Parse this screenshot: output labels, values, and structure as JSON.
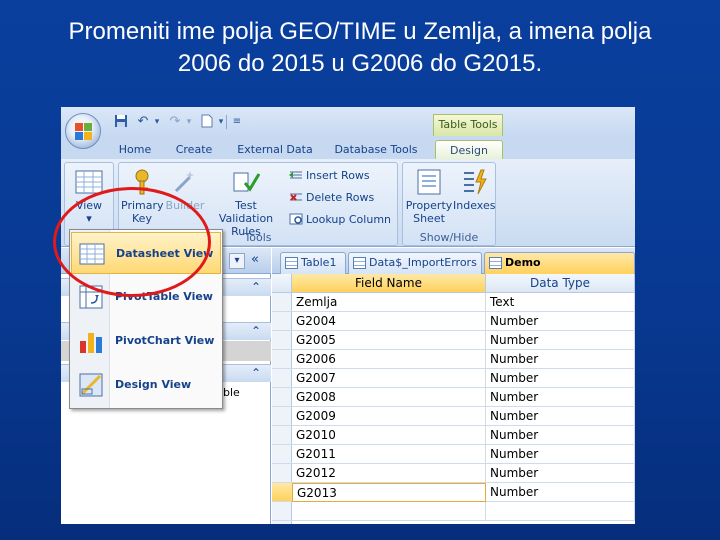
{
  "slide": {
    "title_line1": "Promeniti ime polja GEO/TIME u Zemlja, a imena polja",
    "title_line2": "2006 do 2015 u G2006 do G2015."
  },
  "titlebar": {
    "context_title": "Table Tools"
  },
  "tabs": [
    {
      "label": "Home"
    },
    {
      "label": "Create"
    },
    {
      "label": "External Data"
    },
    {
      "label": "Database Tools"
    },
    {
      "label": "Design",
      "active": true
    }
  ],
  "ribbon": {
    "view": {
      "label": "View",
      "arrow": "▾"
    },
    "tools": {
      "group_label": "Tools",
      "primary_key": "Primary Key",
      "primary_key_l1": "Primary",
      "primary_key_l2": "Key",
      "builder": "Builder",
      "test_validation_l1": "Test Validation",
      "test_validation_l2": "Rules",
      "insert_rows": "Insert Rows",
      "delete_rows": "Delete Rows",
      "lookup_column": "Lookup Column"
    },
    "showhide": {
      "group_label": "Show/Hide",
      "property_l1": "Property",
      "property_l2": "Sheet",
      "indexes": "Indexes"
    }
  },
  "view_menu": [
    {
      "label": "Datasheet View",
      "highlighted": true
    },
    {
      "label": "PivotTable View"
    },
    {
      "label": "PivotChart View"
    },
    {
      "label": "Design View"
    }
  ],
  "nav": {
    "partial_text": "ble"
  },
  "doc_tabs": [
    {
      "label": "Table1"
    },
    {
      "label": "Data$_ImportErrors"
    },
    {
      "label": "Demo",
      "active": true
    }
  ],
  "grid": {
    "columns": [
      "Field Name",
      "Data Type"
    ],
    "rows": [
      {
        "field": "Zemlja",
        "type": "Text"
      },
      {
        "field": "G2004",
        "type": "Number"
      },
      {
        "field": "G2005",
        "type": "Number"
      },
      {
        "field": "G2006",
        "type": "Number"
      },
      {
        "field": "G2007",
        "type": "Number"
      },
      {
        "field": "G2008",
        "type": "Number"
      },
      {
        "field": "G2009",
        "type": "Number"
      },
      {
        "field": "G2010",
        "type": "Number"
      },
      {
        "field": "G2011",
        "type": "Number"
      },
      {
        "field": "G2012",
        "type": "Number"
      },
      {
        "field": "G2013",
        "type": "Number",
        "current": true
      }
    ]
  },
  "icons": {
    "office_button": "office-logo-icon",
    "save": "save-icon",
    "undo": "undo-icon",
    "redo": "redo-icon",
    "new": "new-document-icon",
    "customize": "customize-qat-icon"
  },
  "colors": {
    "slide_bg": "#083a94",
    "ribbon": "#c9dbf1",
    "accent_orange": "#ffd15c",
    "highlight_red": "#e01a1a"
  }
}
